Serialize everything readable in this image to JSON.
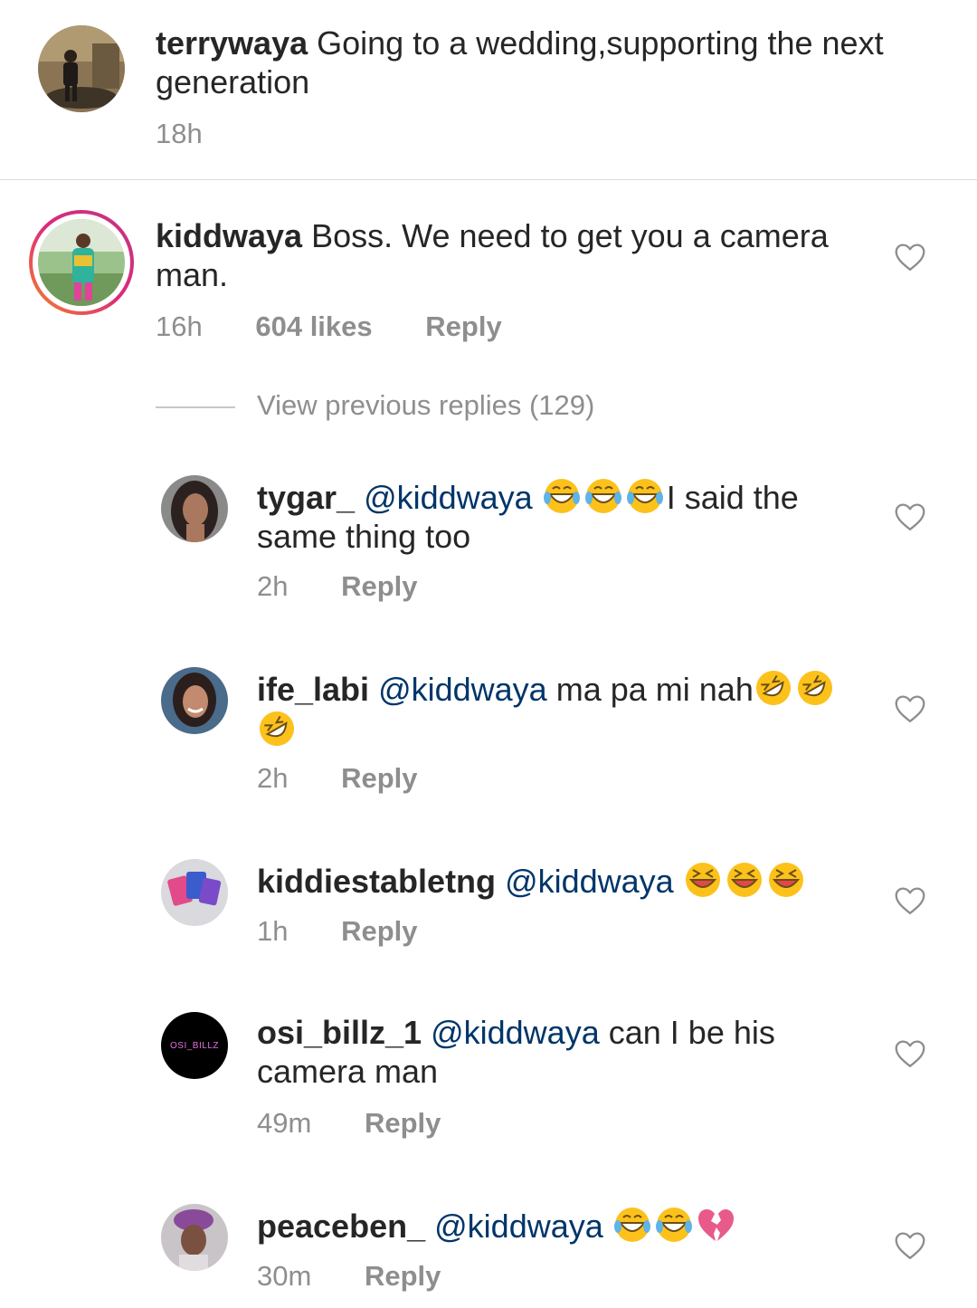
{
  "caption": {
    "username": "terrywaya",
    "text": "Going to a wedding,supporting the next generation",
    "time": "18h"
  },
  "comment": {
    "username": "kiddwaya",
    "text": "Boss. We need to get you a camera man.",
    "time": "16h",
    "likes": "604 likes",
    "reply_label": "Reply"
  },
  "view_previous": "View previous replies (129)",
  "replies": [
    {
      "username": "tygar_",
      "mention": "@kiddwaya",
      "emojis": [
        "tears-of-joy",
        "tears-of-joy",
        "tears-of-joy"
      ],
      "text": "I said the same thing too",
      "time": "2h",
      "reply_label": "Reply"
    },
    {
      "username": "ife_labi",
      "mention": "@kiddwaya",
      "text": "ma pa mi nah",
      "emojis": [
        "rolling-on-floor-laughing",
        "rolling-on-floor-laughing",
        "rolling-on-floor-laughing"
      ],
      "time": "2h",
      "reply_label": "Reply"
    },
    {
      "username": "kiddiestabletng",
      "mention": "@kiddwaya",
      "emojis": [
        "squinting-face",
        "squinting-face",
        "squinting-face"
      ],
      "time": "1h",
      "reply_label": "Reply"
    },
    {
      "username": "osi_billz_1",
      "avatar_text": "OSI_BILLZ",
      "mention": "@kiddwaya",
      "text": "can I be his camera man",
      "time": "49m",
      "reply_label": "Reply"
    },
    {
      "username": "peaceben_",
      "mention": "@kiddwaya",
      "emojis": [
        "tears-of-joy",
        "tears-of-joy",
        "broken-heart"
      ],
      "time": "30m",
      "reply_label": "Reply"
    }
  ],
  "colors": {
    "text": "#262626",
    "muted": "#8e8e8e",
    "mention": "#003569",
    "divider": "#dbdbdb",
    "story_ring_start": "#c13584",
    "story_ring_end": "#f58529"
  }
}
